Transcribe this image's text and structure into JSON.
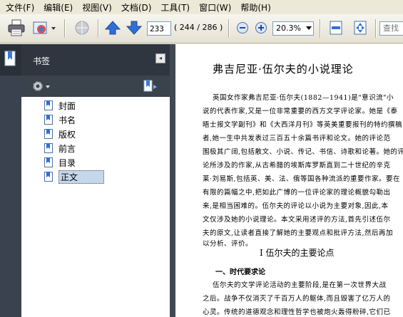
{
  "menu": [
    {
      "label": "文件(F)"
    },
    {
      "label": "编辑(E)"
    },
    {
      "label": "视图(V)"
    },
    {
      "label": "文档(D)"
    },
    {
      "label": "工具(T)"
    },
    {
      "label": "窗口(W)"
    },
    {
      "label": "帮助(H)"
    }
  ],
  "toolbar": {
    "page_current": "233",
    "page_count": "( 244 / 286 )",
    "zoom": "20.3%",
    "search_placeholder": "查找"
  },
  "sidebar": {
    "title": "书签",
    "items": [
      {
        "label": "封面"
      },
      {
        "label": "书名"
      },
      {
        "label": "版权"
      },
      {
        "label": "前言"
      },
      {
        "label": "目录"
      },
      {
        "label": "正文",
        "selected": true
      }
    ]
  },
  "document": {
    "title": "弗吉尼亚·伍尔夫的小说理论",
    "paragraph_lines": [
      "英国女作家弗吉尼亚·伍尔夫(1882—1941)是\"意识流\"小",
      "说的代表作家,又是一位非常重要的西方文学评论家。她是《泰",
      "晤士报文学副刊》和《大西洋月刊》等英美重要报刊的特约撰稿",
      "者,她一生中共发表过三百五十余篇书评和论文。她的评论范",
      "围极其广阔,包括散文、小说、传记、书信、诗歌和论著。她的评",
      "论所涉及的作家,从古希腊的埃斯库罗斯直到二十世纪的辛克",
      "莱·刘易斯,包括英、美、法、俄等国各种流派的重要作家。要在",
      "有限的篇幅之中,把如此广博的一位评论家的理论概貌勾勒出",
      "来,是相当困难的。伍尔夫的评论以小说为主要对象,因此,本",
      "文仅涉及她的小说理论。本文采用述评的方法,首先引述伍尔",
      "夫的原文,让读者直接了解她的主要观点和批评方法,然后再加",
      "以分析、评价。"
    ],
    "section_heading": "I  伍尔夫的主要论点",
    "subheading": "一、时代要求论",
    "section_lines": [
      "伍尔夫的文学评论活动的主要阶段,是在第一次世界大战",
      "之后。战争不仅消灭了千百万人的躯体,而且毁害了亿万人的",
      "心灵。传统的道德观念和理性哲学也被炮火轰得粉碎,它们已"
    ]
  },
  "colors": {
    "menubar_bg": "#ece9d8",
    "panel_dark": "#2f3640",
    "selected_bg": "#c6d7ec",
    "accent_blue": "#3a7bd5"
  }
}
